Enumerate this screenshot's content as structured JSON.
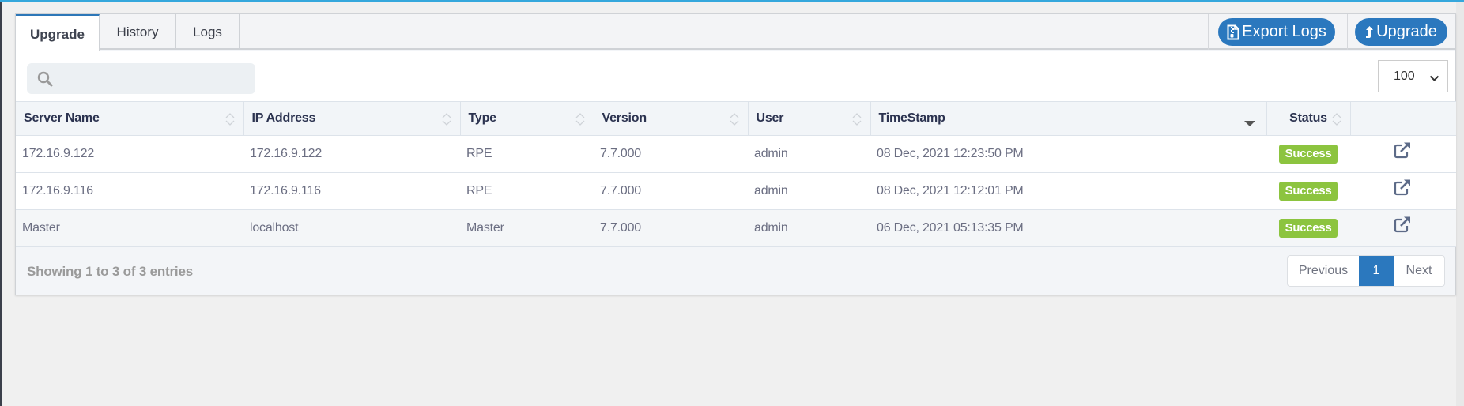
{
  "tabs": [
    {
      "label": "Upgrade",
      "active": true
    },
    {
      "label": "History",
      "active": false
    },
    {
      "label": "Logs",
      "active": false
    }
  ],
  "actions": {
    "export_logs": {
      "label": "Export Logs",
      "icon": "file-zip-icon"
    },
    "upgrade": {
      "label": "Upgrade",
      "icon": "arrow-up-icon"
    }
  },
  "search": {
    "value": "",
    "placeholder": ""
  },
  "page_size": {
    "selected": "100"
  },
  "table": {
    "columns": [
      {
        "label": "Server Name",
        "sort": "none"
      },
      {
        "label": "IP Address",
        "sort": "none"
      },
      {
        "label": "Type",
        "sort": "none"
      },
      {
        "label": "Version",
        "sort": "none"
      },
      {
        "label": "User",
        "sort": "none"
      },
      {
        "label": "TimeStamp",
        "sort": "desc"
      },
      {
        "label": "Status",
        "sort": "none"
      },
      {
        "label": "",
        "sort": "none"
      }
    ],
    "rows": [
      {
        "server": "172.16.9.122",
        "ip": "172.16.9.122",
        "type": "RPE",
        "version": "7.7.000",
        "user": "admin",
        "timestamp": "08 Dec, 2021 12:23:50 PM",
        "status": "Success"
      },
      {
        "server": "172.16.9.116",
        "ip": "172.16.9.116",
        "type": "RPE",
        "version": "7.7.000",
        "user": "admin",
        "timestamp": "08 Dec, 2021 12:12:01 PM",
        "status": "Success"
      },
      {
        "server": "Master",
        "ip": "localhost",
        "type": "Master",
        "version": "7.7.000",
        "user": "admin",
        "timestamp": "06 Dec, 2021 05:13:35 PM",
        "status": "Success"
      }
    ]
  },
  "footer": {
    "info": "Showing 1 to 3 of 3 entries",
    "pagination": {
      "previous": "Previous",
      "current": "1",
      "next": "Next"
    }
  },
  "colors": {
    "accent": "#2b78be",
    "success": "#8cc43f",
    "topline": "#35a7dc"
  }
}
